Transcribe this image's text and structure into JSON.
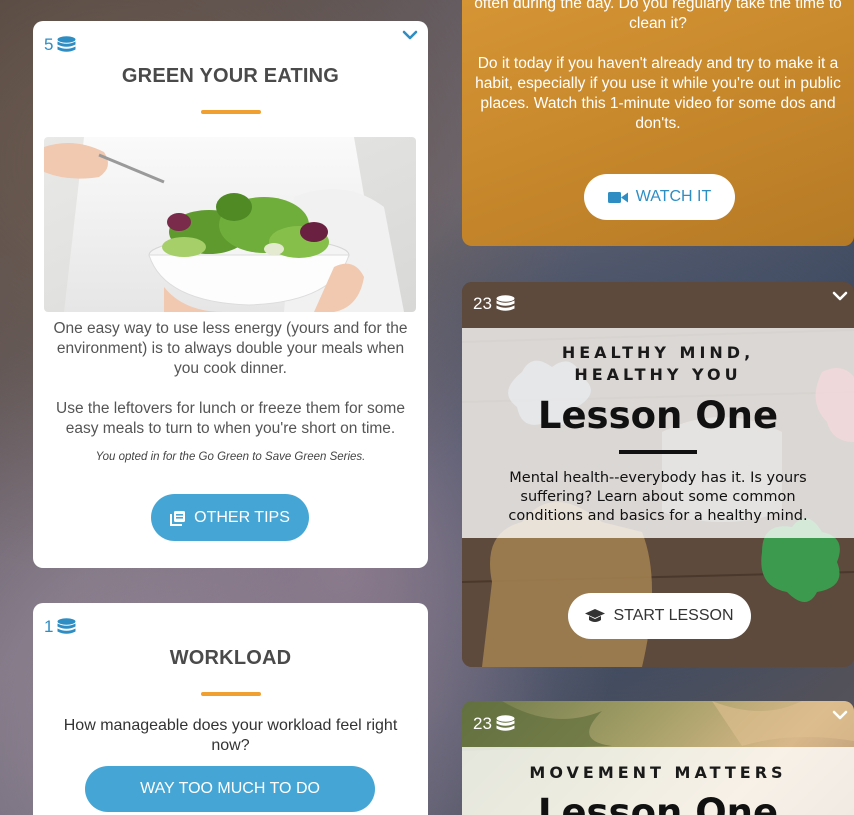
{
  "green_card": {
    "points": "5",
    "title": "GREEN YOUR EATING",
    "paragraph1": "One easy way to use less energy (yours and for the environment) is to always double your meals when you cook dinner.",
    "paragraph2": "Use the leftovers for lunch or freeze them for some easy meals to turn to when you're short on time.",
    "optin_note": "You opted in for the Go Green to Save Green Series.",
    "button_label": "OTHER TIPS"
  },
  "workload_card": {
    "points": "1",
    "title": "WORKLOAD",
    "question": "How manageable does your workload feel right now?",
    "option1_label": "WAY TOO MUCH TO DO"
  },
  "video_card": {
    "text_top": "often during the day. Do you regularly take the time to clean it?",
    "paragraph": "Do it today if you haven't already and try to make it a habit, especially if you use it while you're out in public places. Watch this 1-minute video for some dos and don'ts.",
    "button_label": "WATCH IT"
  },
  "mind_card": {
    "points": "23",
    "series_line1": "HEALTHY MIND,",
    "series_line2": "HEALTHY YOU",
    "lesson_title": "Lesson One",
    "description": "Mental health--everybody has it. Is yours suffering? Learn about some common conditions and basics for a healthy mind.",
    "button_label": "START LESSON"
  },
  "movement_card": {
    "points": "23",
    "series": "MOVEMENT MATTERS",
    "lesson_title": "Lesson One"
  },
  "colors": {
    "accent_blue": "#45a6d5",
    "accent_orange": "#f0a030",
    "video_card_bg": "#c98a2e"
  },
  "icons": {
    "points": "coin-stack-icon",
    "collapse": "chevron-down-icon",
    "video": "video-camera-icon",
    "tips": "copy-icon",
    "lesson": "graduation-cap-icon"
  }
}
